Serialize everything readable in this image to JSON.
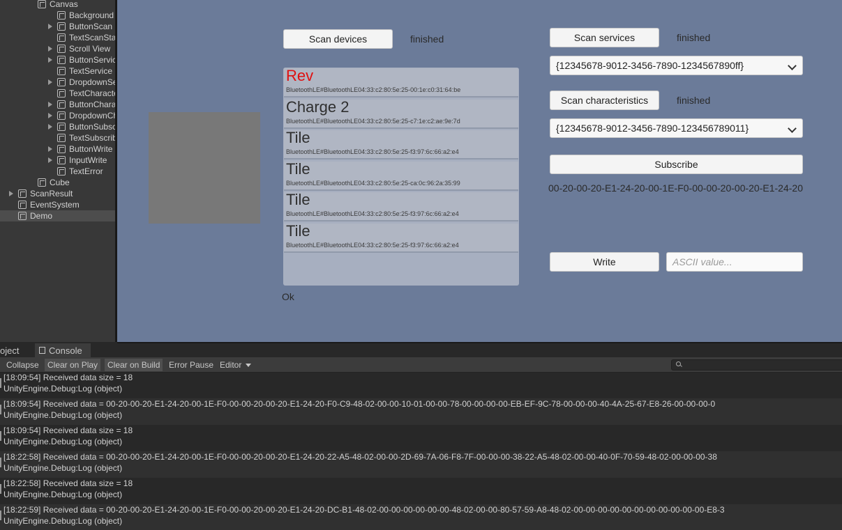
{
  "hierarchy": {
    "items": [
      {
        "label": "Canvas",
        "indent": 1
      },
      {
        "label": "Background",
        "indent": 2
      },
      {
        "label": "ButtonScan",
        "indent": 2,
        "arrow": true
      },
      {
        "label": "TextScanStatus",
        "indent": 2
      },
      {
        "label": "Scroll View",
        "indent": 2,
        "arrow": true
      },
      {
        "label": "ButtonService",
        "indent": 2,
        "arrow": true
      },
      {
        "label": "TextService",
        "indent": 2
      },
      {
        "label": "DropdownServic",
        "indent": 2,
        "arrow": true
      },
      {
        "label": "TextCharacterist",
        "indent": 2
      },
      {
        "label": "ButtonCharacter",
        "indent": 2,
        "arrow": true
      },
      {
        "label": "DropdownChara",
        "indent": 2,
        "arrow": true
      },
      {
        "label": "ButtonSubscribe",
        "indent": 2,
        "arrow": true
      },
      {
        "label": "TextSubscribe",
        "indent": 2
      },
      {
        "label": "ButtonWrite",
        "indent": 2,
        "arrow": true
      },
      {
        "label": "InputWrite",
        "indent": 2,
        "arrow": true
      },
      {
        "label": "TextError",
        "indent": 2
      },
      {
        "label": "Cube",
        "indent": 1
      },
      {
        "label": "ScanResult",
        "indent": 0,
        "arrow": true
      },
      {
        "label": "EventSystem",
        "indent": 0
      },
      {
        "label": "Demo",
        "indent": 0,
        "selected": true
      }
    ]
  },
  "game": {
    "scan_devices_label": "Scan devices",
    "scan_status": "finished",
    "devices": [
      {
        "name": "Rev",
        "id": "BluetoothLE#BluetoothLE04:33:c2:80:5e:25-00:1e:c0:31:64:be",
        "highlight": true
      },
      {
        "name": "Charge 2",
        "id": "BluetoothLE#BluetoothLE04:33:c2:80:5e:25-c7:1e:c2:ae:9e:7d"
      },
      {
        "name": "Tile",
        "id": "BluetoothLE#BluetoothLE04:33:c2:80:5e:25-f3:97:6c:66:a2:e4"
      },
      {
        "name": "Tile",
        "id": "BluetoothLE#BluetoothLE04:33:c2:80:5e:25-ca:0c:96:2a:35:99"
      },
      {
        "name": "Tile",
        "id": "BluetoothLE#BluetoothLE04:33:c2:80:5e:25-f3:97:6c:66:a2:e4"
      },
      {
        "name": "Tile",
        "id": "BluetoothLE#BluetoothLE04:33:c2:80:5e:25-f3:97:6c:66:a2:e4"
      }
    ],
    "error_text": "Ok",
    "scan_services_label": "Scan services",
    "service_status": "finished",
    "service_selected": "{12345678-9012-3456-7890-1234567890ff}",
    "scan_characteristics_label": "Scan characteristics",
    "characteristic_status": "finished",
    "characteristic_selected": "{12345678-9012-3456-7890-123456789011}",
    "subscribe_label": "Subscribe",
    "subscribe_text": "00-20-00-20-E1-24-20-00-1E-F0-00-00-20-00-20-E1-24-20",
    "write_label": "Write",
    "write_placeholder": "ASCII value..."
  },
  "console": {
    "tabs": [
      "oject",
      "Console"
    ],
    "toolbar": {
      "collapse": "Collapse",
      "clear_on_play": "Clear on Play",
      "clear_on_build": "Clear on Build",
      "error_pause": "Error Pause",
      "editor": "Editor"
    },
    "logs": [
      {
        "line1": "[18:09:54] Received data size = 18",
        "line2": "UnityEngine.Debug:Log (object)"
      },
      {
        "line1": "[18:09:54] Received data = 00-20-00-20-E1-24-20-00-1E-F0-00-00-20-00-20-E1-24-20-F0-C9-48-02-00-00-10-01-00-00-78-00-00-00-00-EB-EF-9C-78-00-00-00-40-4A-25-67-E8-26-00-00-00-0",
        "line2": "UnityEngine.Debug:Log (object)"
      },
      {
        "line1": "[18:09:54] Received data size = 18",
        "line2": "UnityEngine.Debug:Log (object)"
      },
      {
        "line1": "[18:22:58] Received data = 00-20-00-20-E1-24-20-00-1E-F0-00-00-20-00-20-E1-24-20-22-A5-48-02-00-00-2D-69-7A-06-F8-7F-00-00-00-38-22-A5-48-02-00-00-40-0F-70-59-48-02-00-00-00-38",
        "line2": "UnityEngine.Debug:Log (object)"
      },
      {
        "line1": "[18:22:58] Received data size = 18",
        "line2": "UnityEngine.Debug:Log (object)"
      },
      {
        "line1": "[18:22:59] Received data = 00-20-00-20-E1-24-20-00-1E-F0-00-00-20-00-20-E1-24-20-DC-B1-48-02-00-00-00-00-00-00-48-02-00-00-80-57-59-A8-48-02-00-00-00-00-00-00-00-00-00-00-00-E8-3",
        "line2": "UnityEngine.Debug:Log (object)"
      }
    ]
  }
}
